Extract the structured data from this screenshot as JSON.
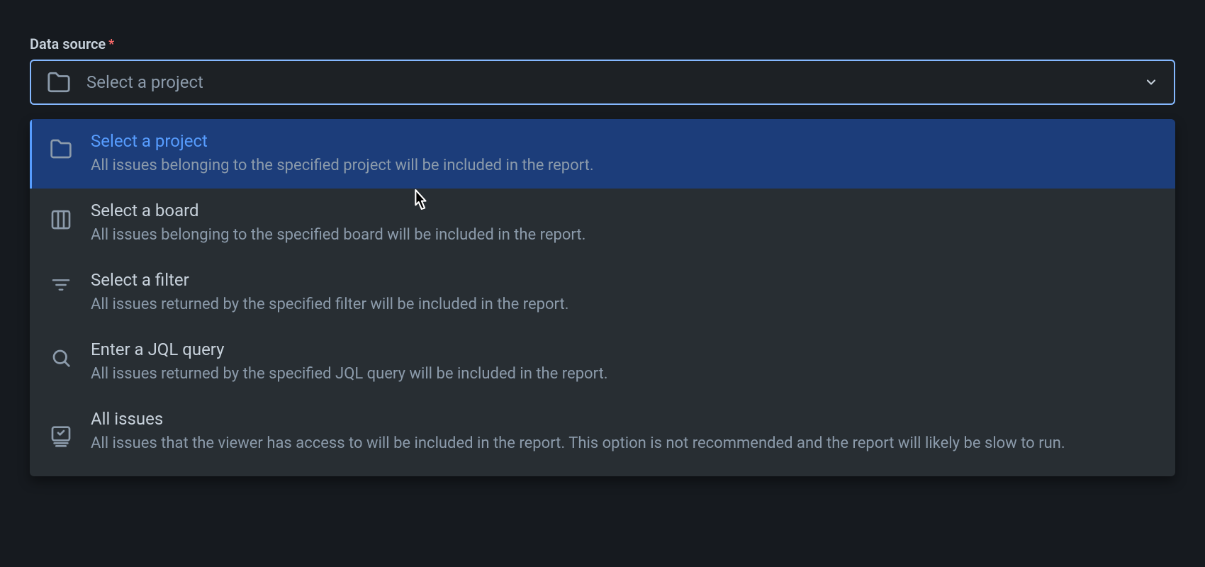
{
  "field": {
    "label": "Data source",
    "required": true,
    "placeholder": "Select a project"
  },
  "options": [
    {
      "icon": "folder-icon",
      "title": "Select a project",
      "description": "All issues belonging to the specified project will be included in the report.",
      "selected": true
    },
    {
      "icon": "board-icon",
      "title": "Select a board",
      "description": "All issues belonging to the specified board will be included in the report.",
      "selected": false
    },
    {
      "icon": "filter-icon",
      "title": "Select a filter",
      "description": "All issues returned by the specified filter will be included in the report.",
      "selected": false
    },
    {
      "icon": "search-icon",
      "title": "Enter a JQL query",
      "description": "All issues returned by the specified JQL query will be included in the report.",
      "selected": false
    },
    {
      "icon": "all-issues-icon",
      "title": "All issues",
      "description": "All issues that the viewer has access to will be included in the report. This option is not recommended and the report will likely be slow to run.",
      "selected": false
    }
  ]
}
